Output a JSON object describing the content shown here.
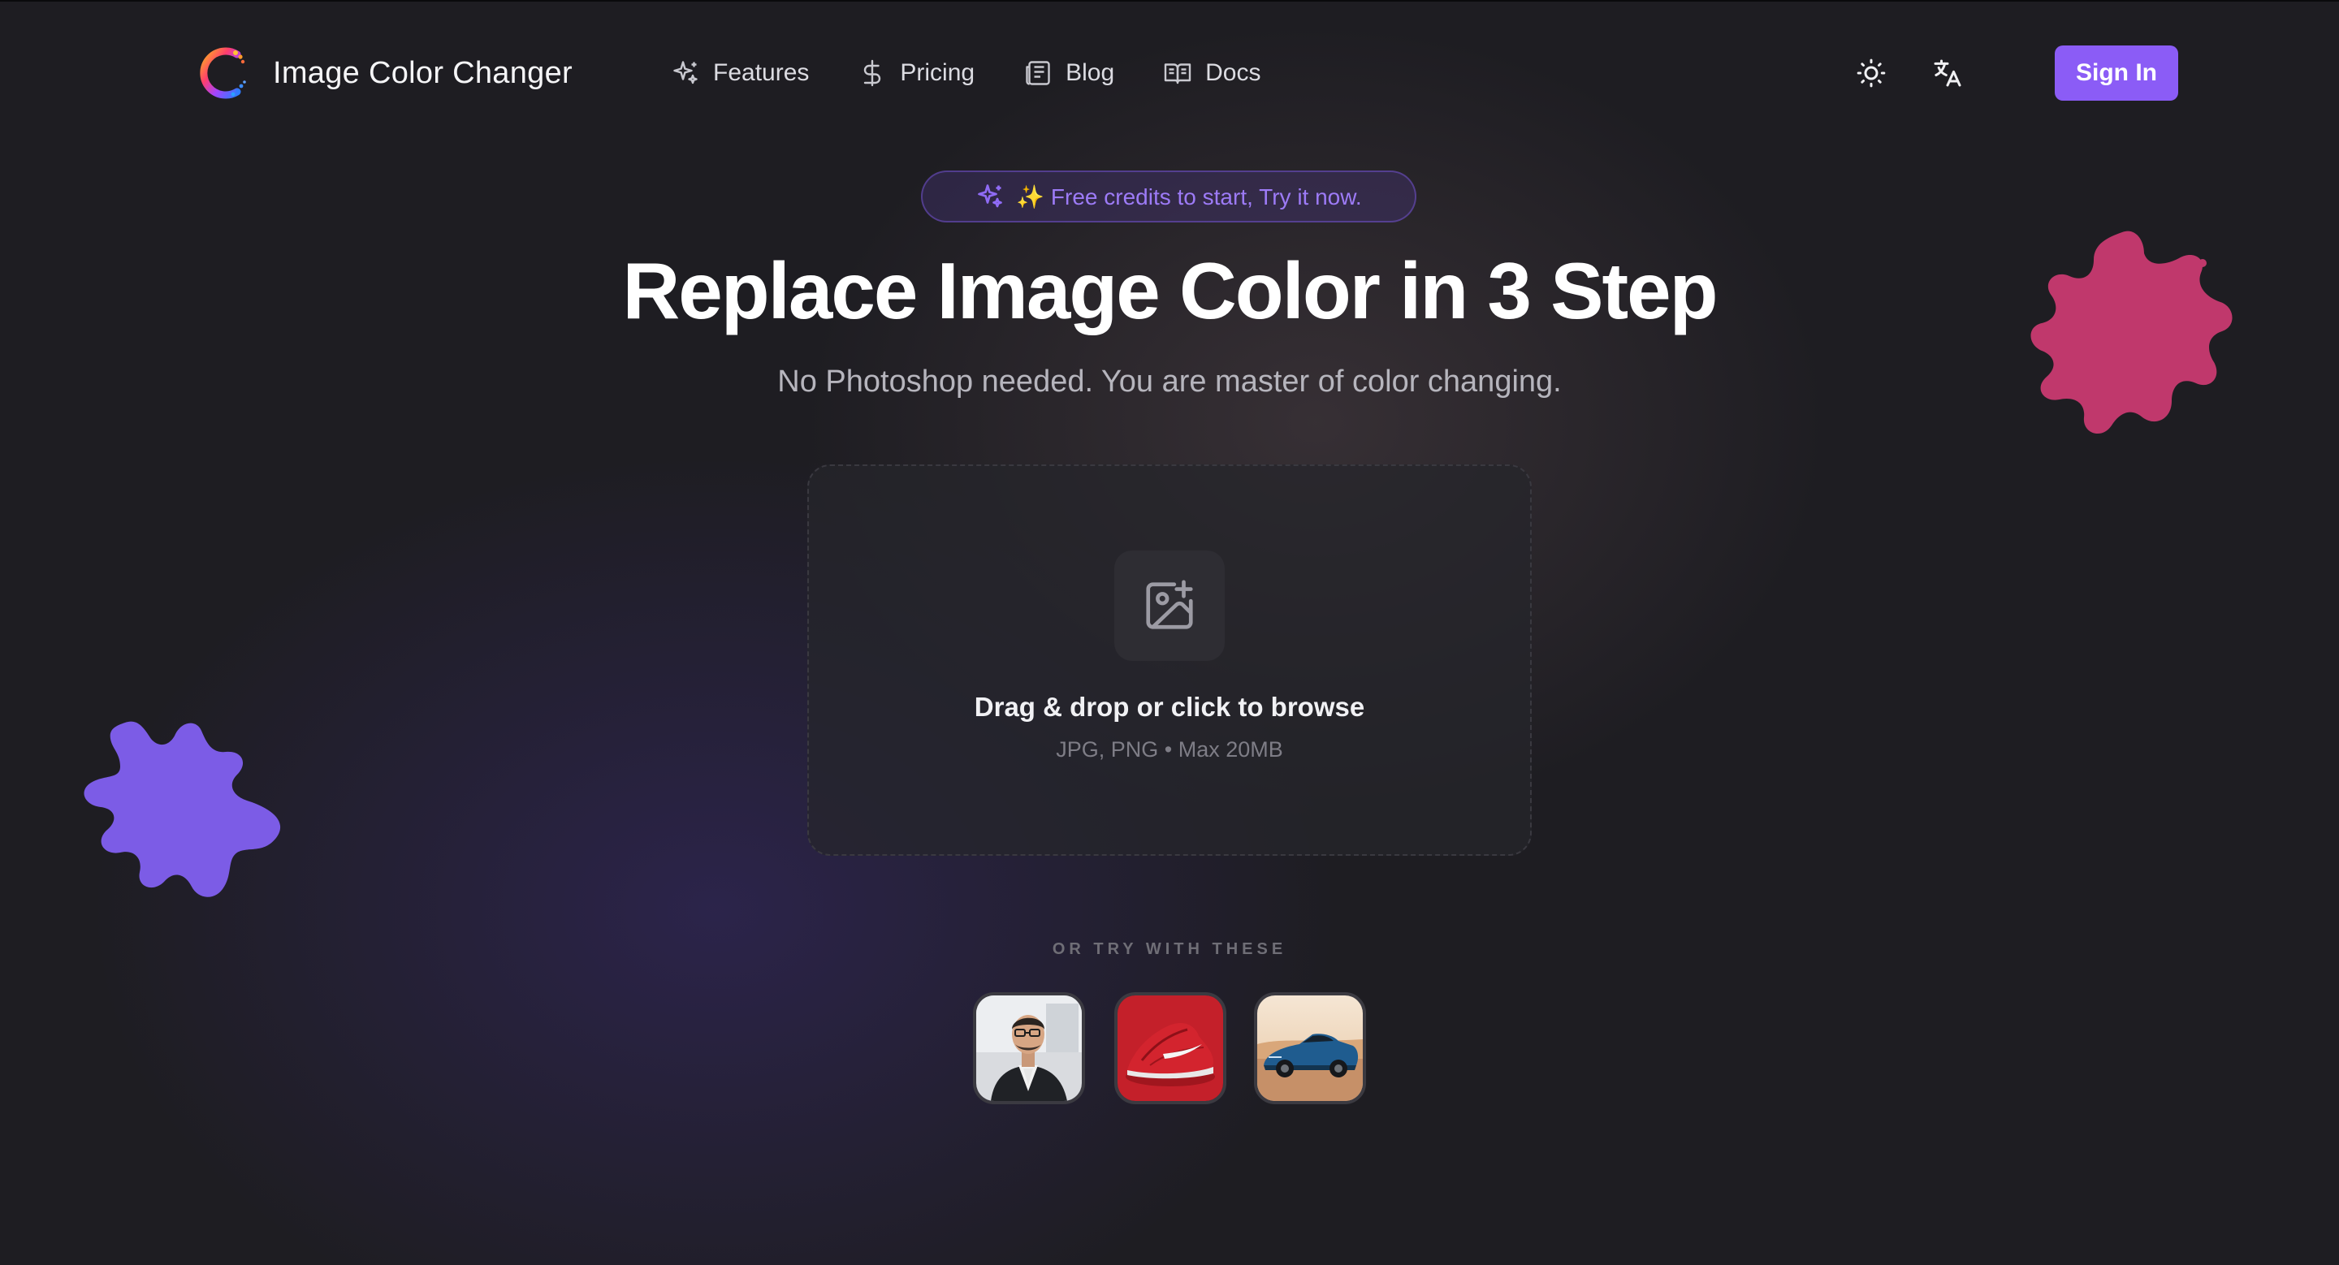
{
  "brand": {
    "name": "Image Color Changer",
    "logo_icon": "rainbow-c-logo"
  },
  "nav": {
    "items": [
      {
        "label": "Features",
        "icon": "sparkles-icon"
      },
      {
        "label": "Pricing",
        "icon": "dollar-icon"
      },
      {
        "label": "Blog",
        "icon": "newspaper-icon"
      },
      {
        "label": "Docs",
        "icon": "book-open-icon"
      }
    ],
    "theme_toggle_icon": "sun-icon",
    "language_icon": "translate-icon",
    "signin_label": "Sign In"
  },
  "hero": {
    "promo": "✨ Free credits to start, Try it now.",
    "title": "Replace Image Color in 3 Step",
    "subtitle": "No Photoshop needed. You are master of color changing."
  },
  "upload": {
    "icon": "image-plus-icon",
    "title": "Drag & drop or click to browse",
    "hint": "JPG, PNG • Max 20MB"
  },
  "samples": {
    "label": "OR TRY WITH THESE",
    "items": [
      {
        "subject": "man-in-suit"
      },
      {
        "subject": "red-sneaker"
      },
      {
        "subject": "blue-sports-car"
      }
    ]
  },
  "colors": {
    "background": "#1e1d22",
    "accent": "#8b5cf6",
    "promo_text": "#9d7bf7",
    "blob_pink": "#c0386c",
    "blob_purple": "#7c5ce6"
  }
}
